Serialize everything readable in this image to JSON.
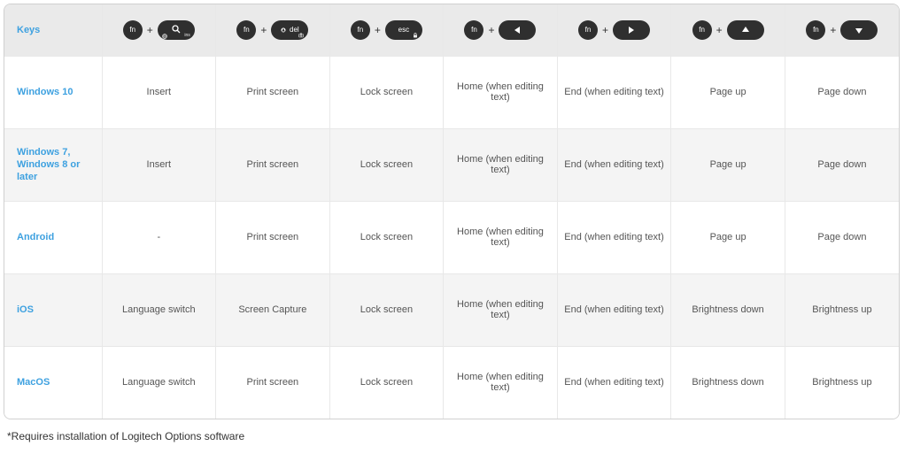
{
  "header_label": "Keys",
  "plus_glyph": "+",
  "fn_label": "fn",
  "key_icons": [
    "search-ins",
    "del",
    "esc",
    "arrow-left",
    "arrow-right",
    "arrow-up",
    "arrow-down"
  ],
  "key_sub_left": [
    "",
    "",
    "",
    "",
    "",
    "",
    ""
  ],
  "key_sub_right": [
    "ins",
    "",
    "",
    "",
    "",
    "",
    ""
  ],
  "key_main_text": [
    "",
    "del",
    "esc",
    "",
    "",
    "",
    ""
  ],
  "rows": [
    {
      "os": "Windows 10",
      "cells": [
        "Insert",
        "Print screen",
        "Lock screen",
        "Home (when editing text)",
        "End (when editing text)",
        "Page up",
        "Page down"
      ]
    },
    {
      "os": "Windows 7, Windows 8 or later",
      "cells": [
        "Insert",
        "Print screen",
        "Lock screen",
        "Home (when editing text)",
        "End (when editing text)",
        "Page up",
        "Page down"
      ]
    },
    {
      "os": "Android",
      "cells": [
        "-",
        "Print screen",
        "Lock screen",
        "Home (when editing text)",
        "End (when editing text)",
        "Page up",
        "Page down"
      ]
    },
    {
      "os": "iOS",
      "cells": [
        "Language switch",
        "Screen Capture",
        "Lock screen",
        "Home (when editing text)",
        "End (when editing text)",
        "Brightness down",
        "Brightness up"
      ]
    },
    {
      "os": "MacOS",
      "cells": [
        "Language switch",
        "Print screen",
        "Lock screen",
        "Home (when editing text)",
        "End (when editing text)",
        "Brightness down",
        "Brightness up"
      ]
    }
  ],
  "footnote": "*Requires installation of Logitech Options software"
}
